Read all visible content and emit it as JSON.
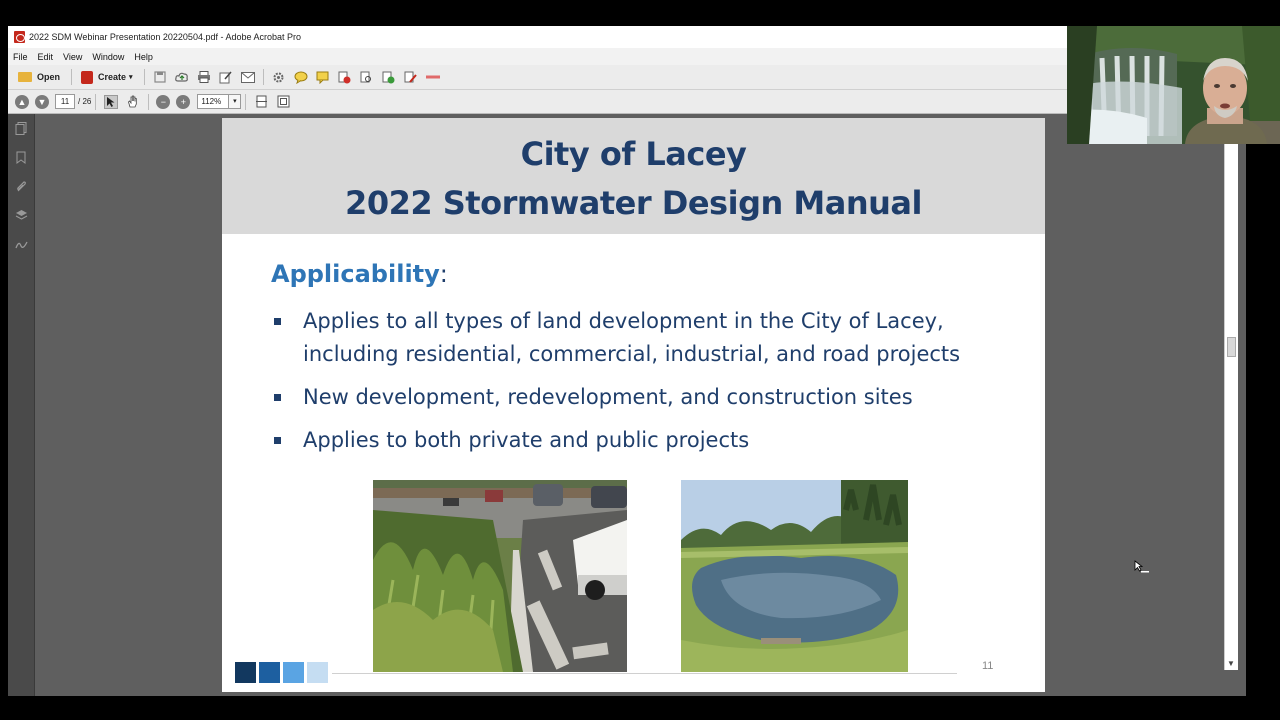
{
  "window": {
    "title": "2022 SDM Webinar Presentation 20220504.pdf - Adobe Acrobat Pro"
  },
  "menu": [
    "File",
    "Edit",
    "View",
    "Window",
    "Help"
  ],
  "toolbar": {
    "open_label": "Open",
    "create_label": "Create"
  },
  "nav": {
    "current_page": "11",
    "total_pages": "/ 26",
    "zoom": "112%"
  },
  "slide": {
    "title_line1": "City of Lacey",
    "title_line2": "2022 Stormwater Design Manual",
    "subheading": "Applicability",
    "subheading_suffix": ":",
    "bullets": [
      "Applies to all types of land development in the City of Lacey, including residential, commercial, industrial, and road projects",
      "New development, redevelopment, and construction sites",
      "Applies to both private and public projects"
    ],
    "page_number": "11",
    "footer_square_colors": [
      "#12385f",
      "#1d5fa0",
      "#5aa4e3",
      "#c5ddf2"
    ],
    "title_color": "#1f3e6b",
    "accent_color": "#2e75b6"
  }
}
